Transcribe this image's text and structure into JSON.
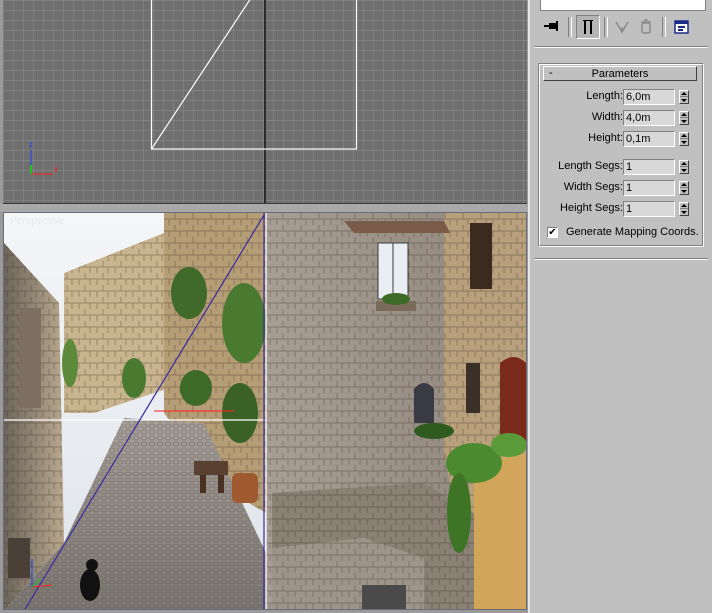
{
  "viewports": {
    "perspective_label": "Perspective"
  },
  "toolbar": {
    "icons": [
      "pin-stack-icon",
      "show-end-result-icon",
      "make-unique-icon",
      "remove-modifier-icon",
      "configure-modifier-sets-icon"
    ],
    "active": "show-end-result-icon"
  },
  "parameters": {
    "title": "Parameters",
    "toggle": "-",
    "length": {
      "label": "Length:",
      "value": "6,0m"
    },
    "width": {
      "label": "Width:",
      "value": "4,0m"
    },
    "height": {
      "label": "Height:",
      "value": "0,1m"
    },
    "length_segs": {
      "label": "Length Segs:",
      "value": "1"
    },
    "width_segs": {
      "label": "Width Segs:",
      "value": "1"
    },
    "height_segs": {
      "label": "Height Segs:",
      "value": "1"
    },
    "generate_mapping": {
      "label": "Generate Mapping Coords.",
      "checked": true,
      "check_glyph": "✔"
    }
  },
  "colors": {
    "viewport_bg": "#6f6f6f",
    "grid_major": "#000000",
    "object_white": "#ffffff",
    "selection_purple": "#3a2aa0",
    "axis_x": "#ff2020",
    "axis_y": "#20c020",
    "axis_z": "#2040ff"
  }
}
